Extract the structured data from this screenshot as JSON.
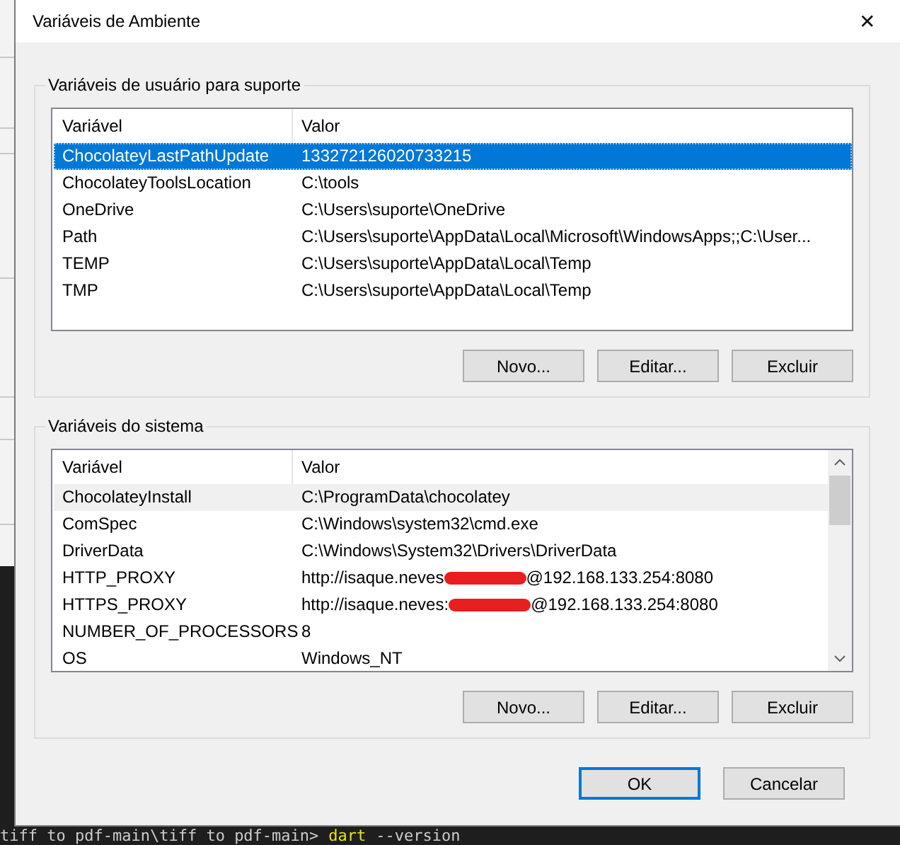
{
  "window": {
    "title": "Variáveis de Ambiente",
    "close": "✕"
  },
  "user_group": {
    "title": "Variáveis de usuário para suporte",
    "focused": true,
    "columns": [
      "Variável",
      "Valor"
    ],
    "rows": [
      {
        "name": "ChocolateyLastPathUpdate",
        "value": "133272126020733215",
        "selected": true
      },
      {
        "name": "ChocolateyToolsLocation",
        "value": "C:\\tools",
        "selected": false
      },
      {
        "name": "OneDrive",
        "value": "C:\\Users\\suporte\\OneDrive",
        "selected": false
      },
      {
        "name": "Path",
        "value": "C:\\Users\\suporte\\AppData\\Local\\Microsoft\\WindowsApps;;C:\\User...",
        "selected": false
      },
      {
        "name": "TEMP",
        "value": "C:\\Users\\suporte\\AppData\\Local\\Temp",
        "selected": false
      },
      {
        "name": "TMP",
        "value": "C:\\Users\\suporte\\AppData\\Local\\Temp",
        "selected": false
      }
    ],
    "buttons": [
      "Novo...",
      "Editar...",
      "Excluir"
    ]
  },
  "system_group": {
    "title": "Variáveis do sistema",
    "focused": false,
    "scrollbar": true,
    "columns": [
      "Variável",
      "Valor"
    ],
    "rows": [
      {
        "name": "ChocolateyInstall",
        "value": "C:\\ProgramData\\chocolatey",
        "selected": true
      },
      {
        "name": "ComSpec",
        "value": "C:\\Windows\\system32\\cmd.exe",
        "selected": false
      },
      {
        "name": "DriverData",
        "value": "C:\\Windows\\System32\\Drivers\\DriverData",
        "selected": false
      },
      {
        "name": "HTTP_PROXY",
        "value": "http://isaque.neves",
        "value_after": "@192.168.133.254:8080",
        "redacted": true,
        "selected": false
      },
      {
        "name": "HTTPS_PROXY",
        "value": "http://isaque.neves:",
        "value_after": "@192.168.133.254:8080",
        "redacted": true,
        "selected": false
      },
      {
        "name": "NUMBER_OF_PROCESSORS",
        "value": "8",
        "selected": false
      },
      {
        "name": "OS",
        "value": "Windows_NT",
        "selected": false
      }
    ],
    "buttons": [
      "Novo...",
      "Editar...",
      "Excluir"
    ]
  },
  "dialog_buttons": [
    {
      "label": "OK",
      "default": true
    },
    {
      "label": "Cancelar",
      "default": false
    }
  ],
  "terminal": {
    "path": "tiff to pdf-main\\tiff to pdf-main>",
    "command": "dart",
    "args": "--version"
  }
}
